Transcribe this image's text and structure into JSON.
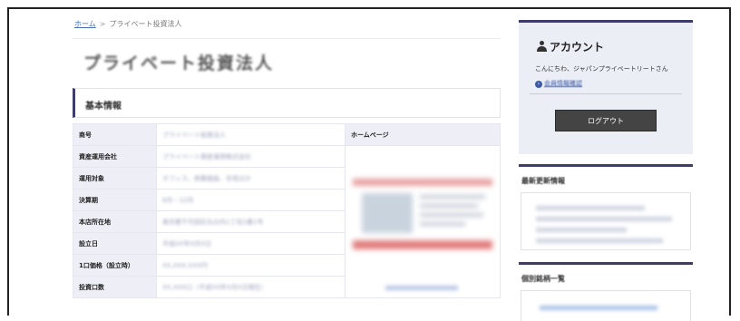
{
  "breadcrumb": {
    "home": "ホーム",
    "separator": ">",
    "current": "プライベート投資法人"
  },
  "page_title": "プライベート投資法人",
  "section_title": "基本情報",
  "info_table": {
    "rows": [
      {
        "label": "商号",
        "value": "プライベート投資法人"
      },
      {
        "label": "資産運用会社",
        "value": "プライベート資産運用株式会社"
      },
      {
        "label": "運用対象",
        "value": "オフィス、商業施設、住宅ほか"
      },
      {
        "label": "決算期",
        "value": "6月・12月"
      },
      {
        "label": "本店所在地",
        "value": "東京都千代田区丸の内1丁目1番1号"
      },
      {
        "label": "設立日",
        "value": "平成XX年X月X日"
      },
      {
        "label": "1口価格（設立時）",
        "value": "XX,XXX,XXX円"
      },
      {
        "label": "投資口数",
        "value": "XX,XXX口（平成XX年X月X日現在）"
      }
    ],
    "homepage_label": "ホームページ"
  },
  "sidebar": {
    "account": {
      "icon": "user-icon",
      "title": "アカウント",
      "greeting": "こんにちわ、ジャパンプライベートリートさん",
      "member_link": "会員情報確認",
      "logout_label": "ログアウト"
    },
    "updates_title": "最新更新情報",
    "stocks_title": "個別銘柄一覧"
  },
  "colors": {
    "accent": "#3d3d6b",
    "button": "#444444",
    "link": "#3a5aa8"
  }
}
